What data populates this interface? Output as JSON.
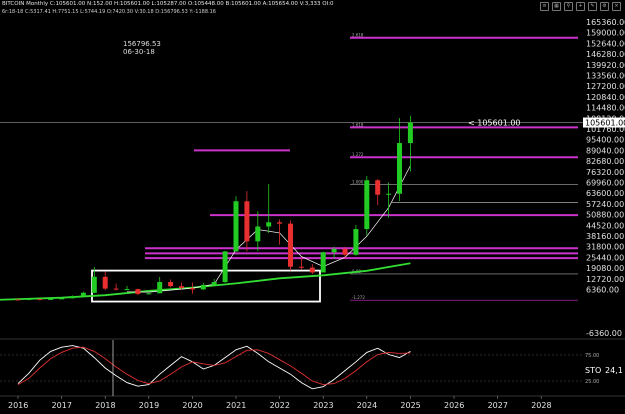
{
  "header": {
    "title": "BITCOIN Monthly  C:105601.00  N:152.00  H:105601.00  L:105287.00  O:105448.00  B:105601.00  A:105654.00  V:3,333  OI:0",
    "info": "6r:18-18  C:5317.41  H:7751.15  L:5744.19  O:7420.30  V:30.18  D:156796.53  Y:-1188.16",
    "icons": [
      "menu-icon",
      "grid-icon",
      "search-icon",
      "zoom-icon",
      "pencil-icon",
      "gear-icon",
      "close-icon"
    ]
  },
  "annotation": {
    "value": "156796.53",
    "date": "06-30-18"
  },
  "price_callout": "< 105601.00",
  "colors": {
    "background": "#000000",
    "up": "#22cc22",
    "down": "#e83030",
    "fib": "#cc33cc",
    "box": "#ffffff",
    "ma": "#33dd33",
    "stoch_k": "#ffffff",
    "stoch_d": "#e03030"
  },
  "chart_data": [
    {
      "type": "candlestick",
      "title": "",
      "x_axis_labels": [
        "2016",
        "2017",
        "2018",
        "2019",
        "2020",
        "2021",
        "2022",
        "2023",
        "2024",
        "2025",
        "2026",
        "2027",
        "2028"
      ],
      "y_axis_labels": [
        "165360.00",
        "159000.00",
        "152640.00",
        "146280.00",
        "139920.00",
        "133560.00",
        "127200.00",
        "120840.00",
        "114480.00",
        "108120.00",
        "101760.00",
        "95400.00",
        "89040.00",
        "82680.00",
        "76320.00",
        "69960.00",
        "63600.00",
        "57240.00",
        "50880.00",
        "44520.00",
        "38160.00",
        "31800.00",
        "25440.00",
        "19080.00",
        "12720.00",
        "6360.00",
        "-6360.00"
      ],
      "last_price": "105601.00",
      "fib_levels": [
        {
          "label": "2.618",
          "value": 156000
        },
        {
          "label": "1.618",
          "value": 102700
        },
        {
          "label": "1.272",
          "value": 85000
        },
        {
          "label": "1.000",
          "value": 68800
        },
        {
          "label": "",
          "value": 58000
        },
        {
          "label": "",
          "value": 50600
        },
        {
          "label": "",
          "value": 30900
        },
        {
          "label": "",
          "value": 27800
        },
        {
          "label": "",
          "value": 25000
        },
        {
          "label": "0.00",
          "value": 15600
        },
        {
          "label": "-1.272",
          "value": 0
        }
      ],
      "candles": [
        [
          2016.0,
          430,
          460,
          360,
          370
        ],
        [
          2016.25,
          430,
          680,
          410,
          670
        ],
        [
          2016.5,
          670,
          760,
          560,
          610
        ],
        [
          2016.75,
          610,
          780,
          600,
          740
        ],
        [
          2017.0,
          740,
          1300,
          740,
          1100
        ],
        [
          2017.25,
          1100,
          2900,
          1100,
          2500
        ],
        [
          2017.5,
          2500,
          5000,
          1800,
          4400
        ],
        [
          2017.75,
          4400,
          19700,
          4100,
          13900
        ],
        [
          2018.0,
          13900,
          17000,
          5900,
          6900
        ],
        [
          2018.25,
          6900,
          9900,
          5800,
          6400
        ],
        [
          2018.5,
          6400,
          8500,
          5900,
          6600
        ],
        [
          2018.75,
          6600,
          6800,
          3200,
          3700
        ],
        [
          2019.0,
          3700,
          4200,
          3400,
          4100
        ],
        [
          2019.25,
          4100,
          13800,
          4000,
          10800
        ],
        [
          2019.5,
          10800,
          12300,
          7700,
          8300
        ],
        [
          2019.75,
          8300,
          10500,
          6400,
          7200
        ],
        [
          2020.0,
          7200,
          10500,
          3800,
          6400
        ],
        [
          2020.25,
          6400,
          10400,
          6200,
          9100
        ],
        [
          2020.5,
          9100,
          12500,
          9000,
          10800
        ],
        [
          2020.75,
          10800,
          29300,
          10400,
          29000
        ],
        [
          2021.0,
          29000,
          61800,
          28800,
          58800
        ],
        [
          2021.25,
          58800,
          64800,
          29000,
          35000
        ],
        [
          2021.5,
          35000,
          52900,
          29300,
          43800
        ],
        [
          2021.75,
          43800,
          69000,
          40000,
          46300
        ],
        [
          2022.0,
          46300,
          48000,
          33000,
          45500
        ],
        [
          2022.25,
          45500,
          47400,
          17600,
          19900
        ],
        [
          2022.5,
          19900,
          25200,
          18100,
          19400
        ],
        [
          2022.75,
          19400,
          21500,
          15500,
          16500
        ],
        [
          2023.0,
          16500,
          28900,
          16500,
          28500
        ],
        [
          2023.25,
          28500,
          31800,
          24800,
          30500
        ],
        [
          2023.5,
          30500,
          31800,
          24900,
          27000
        ],
        [
          2023.75,
          27000,
          44700,
          26500,
          42300
        ],
        [
          2024.0,
          42300,
          73800,
          38500,
          71300
        ],
        [
          2024.25,
          71300,
          72000,
          56500,
          62700
        ],
        [
          2024.5,
          62700,
          70000,
          49000,
          63300
        ],
        [
          2024.75,
          63300,
          108300,
          58900,
          93400
        ],
        [
          2025.0,
          93400,
          109600,
          76600,
          105601
        ]
      ]
    },
    {
      "type": "line",
      "title": "",
      "label": "STO",
      "value_text": "24,1",
      "y_axis_labels": [
        "75.00",
        "25.00"
      ],
      "series": [
        {
          "name": "",
          "values": [
            20,
            40,
            65,
            82,
            90,
            93,
            88,
            70,
            50,
            35,
            22,
            15,
            18,
            38,
            55,
            72,
            62,
            48,
            55,
            70,
            85,
            92,
            78,
            62,
            50,
            38,
            22,
            10,
            14,
            28,
            45,
            62,
            80,
            88,
            76,
            70,
            82
          ]
        },
        {
          "name": "",
          "values": [
            18,
            30,
            50,
            68,
            80,
            88,
            90,
            82,
            68,
            52,
            38,
            26,
            20,
            25,
            38,
            52,
            62,
            58,
            55,
            60,
            72,
            84,
            85,
            78,
            66,
            54,
            40,
            25,
            18,
            20,
            30,
            45,
            62,
            76,
            80,
            78,
            79
          ]
        }
      ]
    }
  ]
}
